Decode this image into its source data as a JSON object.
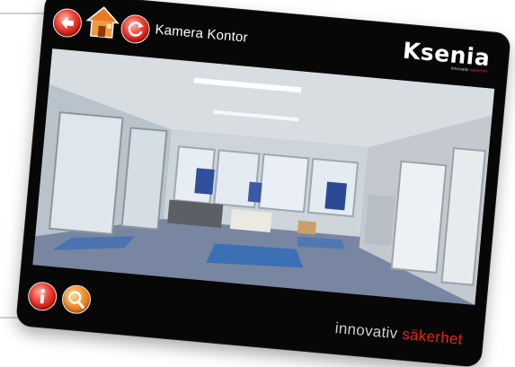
{
  "app": {
    "title": "Kamera Kontor",
    "camera_name": "Kamera Kontor"
  },
  "toolbar": {
    "back_icon": "arrow-left-icon",
    "home_icon": "home-icon",
    "refresh_icon": "refresh-icon"
  },
  "logo": {
    "word": "Ksenia",
    "tagline_prefix": "innovativ ",
    "tagline_accent": "säkerhet"
  },
  "footer": {
    "info_icon": "info-icon",
    "zoom_icon": "magnifier-icon",
    "slogan_prefix": "innovativ ",
    "slogan_accent": "säkerhet"
  },
  "colors": {
    "frame": "#070707",
    "accent_red": "#e8221a",
    "orange": "#f5982f"
  }
}
